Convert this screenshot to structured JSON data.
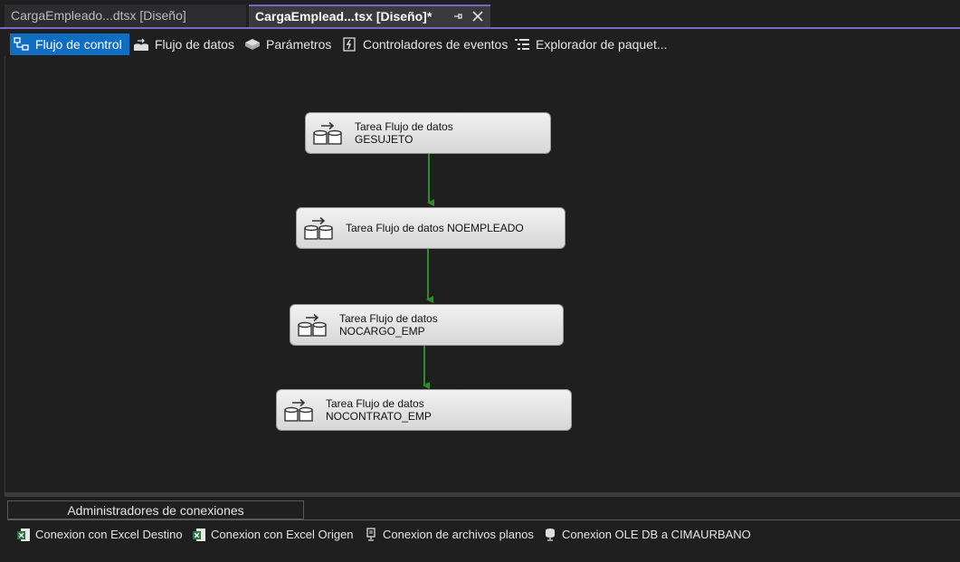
{
  "tabs": [
    {
      "label": "CargaEmpleado...dtsx [Diseño]",
      "active": false
    },
    {
      "label": "CargaEmplead...tsx [Diseño]*",
      "active": true
    }
  ],
  "tab_controls": {
    "pin_icon": "pin-icon",
    "close_icon": "close-icon"
  },
  "designer_tabs": [
    {
      "label": "Flujo de control",
      "icon": "control-flow-icon",
      "selected": true
    },
    {
      "label": "Flujo de datos",
      "icon": "data-flow-icon",
      "selected": false
    },
    {
      "label": "Parámetros",
      "icon": "parameters-icon",
      "selected": false
    },
    {
      "label": "Controladores de eventos",
      "icon": "event-handlers-icon",
      "selected": false
    },
    {
      "label": "Explorador de paquet...",
      "icon": "package-explorer-icon",
      "selected": false
    }
  ],
  "tasks": [
    {
      "line1": "Tarea Flujo de datos",
      "line2": "GESUJETO"
    },
    {
      "line1": "Tarea Flujo de datos NOEMPLEADO",
      "line2": ""
    },
    {
      "line1": "Tarea Flujo de datos",
      "line2": "NOCARGO_EMP"
    },
    {
      "line1": "Tarea Flujo de datos",
      "line2": "NOCONTRATO_EMP"
    }
  ],
  "connection_managers": {
    "header": "Administradores de conexiones",
    "items": [
      {
        "label": "Conexion con Excel Destino",
        "icon": "excel-icon"
      },
      {
        "label": "Conexion con Excel Origen",
        "icon": "excel-icon"
      },
      {
        "label": "Conexion de archivos planos",
        "icon": "flat-file-icon"
      },
      {
        "label": "Conexion OLE DB a CIMAURBANO",
        "icon": "oledb-icon"
      }
    ]
  },
  "colors": {
    "accent": "#7e65c9",
    "selected": "#0f6dc2",
    "precedence": "#2e8b2e"
  }
}
